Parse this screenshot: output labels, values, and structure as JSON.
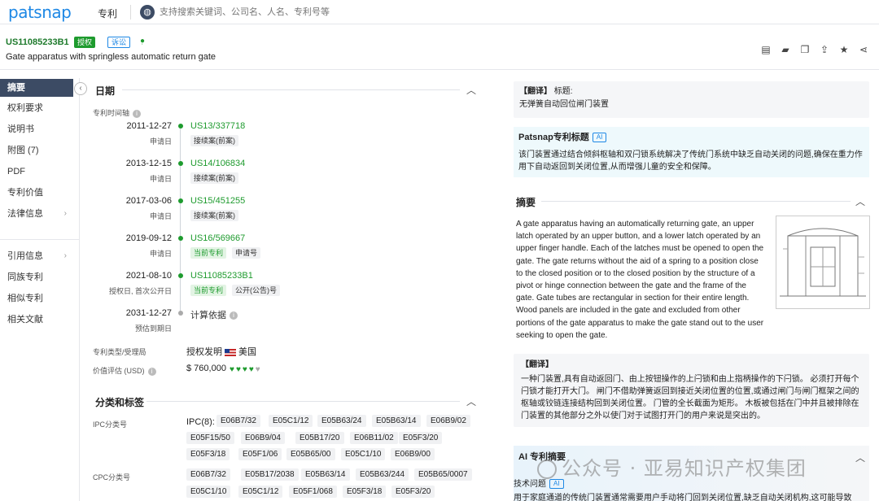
{
  "app": {
    "logo": "patsnap",
    "nav_label": "专利",
    "search_placeholder": "支持搜索关键词、公司名、人名、专利号等"
  },
  "header": {
    "pub_number": "US11085233B1",
    "badge_grant": "授权",
    "badge_litigation": "诉讼",
    "title": "Gate apparatus with springless automatic return gate",
    "toolbar_icons": [
      "note-icon",
      "folder-icon",
      "copy-icon",
      "share-icon",
      "star-icon",
      "share-nodes-icon"
    ]
  },
  "sidebar": {
    "items": [
      {
        "label": "摘要",
        "active": true
      },
      {
        "label": "权利要求"
      },
      {
        "label": "说明书"
      },
      {
        "label": "附图 (7)"
      },
      {
        "label": "PDF"
      },
      {
        "label": "专利价值"
      },
      {
        "label": "法律信息",
        "chevron": true
      },
      {
        "label": "引用信息",
        "chevron": true
      },
      {
        "label": "同族专利"
      },
      {
        "label": "相似专利"
      },
      {
        "label": "相关文献"
      }
    ]
  },
  "dates": {
    "section_title": "日期",
    "timeline_label": "专利时间轴",
    "events": [
      {
        "date": "2011-12-27",
        "sub": "申请日",
        "app_no": "US13/337718",
        "tags": [
          "接续案(前案)"
        ]
      },
      {
        "date": "2013-12-15",
        "sub": "申请日",
        "app_no": "US14/106834",
        "tags": [
          "接续案(前案)"
        ]
      },
      {
        "date": "2017-03-06",
        "sub": "申请日",
        "app_no": "US15/451255",
        "tags": [
          "接续案(前案)"
        ]
      },
      {
        "date": "2019-09-12",
        "sub": "申请日",
        "app_no": "US16/569667",
        "tags": [
          "当前专利",
          "申请号"
        ]
      },
      {
        "date": "2021-08-10",
        "sub": "授权日, 首次公开日",
        "app_no": "US11085233B1",
        "tags": [
          "当前专利",
          "公开(公告)号"
        ]
      },
      {
        "date": "2031-12-27",
        "sub": "预估到期日",
        "app_no": "计算依据",
        "tags": []
      }
    ],
    "type_label": "专利类型/受理局",
    "type_value": "授权发明",
    "country": "美国",
    "value_label": "价值评估 (USD)",
    "value": "$ 760,000",
    "value_gems": {
      "filled": 3.5,
      "total": 5
    }
  },
  "classification": {
    "section_title": "分类和标签",
    "ipc_label": "IPC分类号",
    "ipc_prefix": "IPC(8):",
    "ipc_codes": [
      "E06B7/32",
      "E05C1/12",
      "E05B63/24",
      "E05B63/14",
      "E06B9/02",
      "E05F15/50",
      "E06B9/04",
      "E05B17/20",
      "E06B11/02",
      "E05F3/20",
      "E05F3/18",
      "E05F1/06",
      "E05B65/00",
      "E05C1/10",
      "E06B9/00"
    ],
    "cpc_label": "CPC分类号",
    "cpc_codes": [
      "E06B7/32",
      "E05B17/2038",
      "E05B63/14",
      "E05B63/244",
      "E05B65/0007",
      "E05C1/10",
      "E05C1/12",
      "E05F1/068",
      "E05F3/18",
      "E05F3/20"
    ]
  },
  "right": {
    "title_translation_tag": "【翻译】",
    "title_label": "标题:",
    "title_cn": "无弹簧自动回位闸门装置",
    "patsnap_title_label": "Patsnap专利标题",
    "ai_badge": "AI",
    "patsnap_title_text": "该门装置通过结合倾斜枢轴和双闩锁系统解决了传统门系统中缺乏自动关闭的问题,确保在重力作用下自动返回到关闭位置,从而增强儿童的安全和保障。",
    "abstract_label": "摘要",
    "abstract_en": "A gate apparatus having an automatically returning gate, an upper latch operated by an upper button, and a lower latch operated by an upper finger handle. Each of the latches must be opened to open the gate. The gate returns without the aid of a spring to a position close to the closed position or to the closed position by the structure of a pivot or hinge connection between the gate and the frame of the gate. Gate tubes are rectangular in section for their entire length. Wood panels are included in the gate and excluded from other portions of the gate apparatus to make the gate stand out to the user seeking to open the gate.",
    "abstract_translation_tag": "【翻译】",
    "abstract_cn": "一种门装置,具有自动返回门、由上按钮操作的上闩锁和由上指柄操作的下闩锁。 必须打开每个闩锁才能打开大门。 闸门不借助弹簧返回到接近关闭位置的位置,或通过闸门与闸门框架之间的枢轴或铰链连接结构回到关闭位置。 门管的全长截面为矩形。 木板被包括在门中并且被排除在门装置的其他部分之外以使门对于试图打开门的用户来说是突出的。",
    "ai_summary_label": "AI 专利摘要",
    "tech_problem_label": "技术问题",
    "ai_summary_text": "用于家庭通道的传统门装置通常需要用户手动将门回到关闭位置,缺乏自动关闭机构,这可能导致",
    "watermark": "公众号 · 亚易知识产权集团"
  }
}
